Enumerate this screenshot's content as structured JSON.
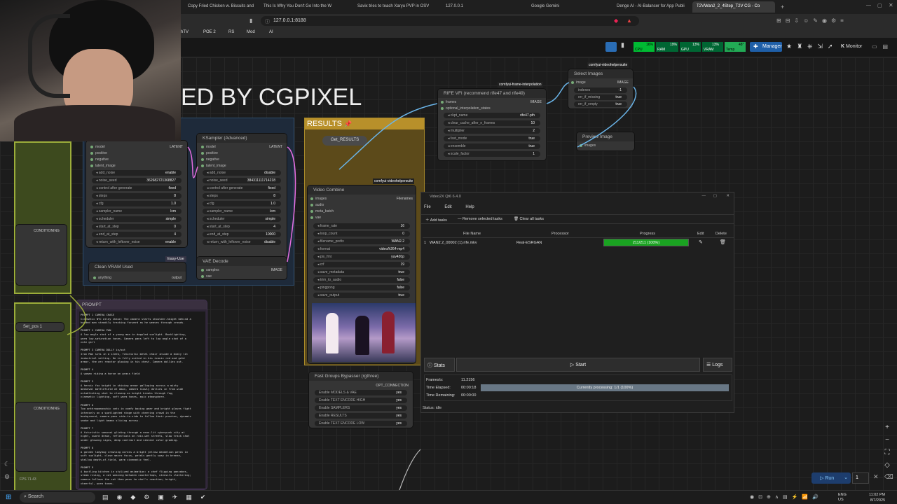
{
  "browser": {
    "tabs": [
      {
        "label": "Copy Fried Chicken w. Biscuits and",
        "active": false
      },
      {
        "label": "This Is Why You Don't Go Into the W",
        "active": false
      },
      {
        "label": "Savix tries to teach Xaryu PVP in OSV",
        "active": false
      },
      {
        "label": "127.0.0.1",
        "active": false
      },
      {
        "label": "Google Gemini",
        "active": false
      },
      {
        "label": "Denge AI - AI-Balancer for App Publi",
        "active": false
      },
      {
        "label": "T2VWan2_2_4Step_T2V CG - Co",
        "active": true
      }
    ],
    "address": "127.0.0.1:8188",
    "bookmarks": [
      "hTV",
      "POE 2",
      "RS",
      "Mod",
      "AI"
    ]
  },
  "topmenu": {
    "stats": [
      {
        "label": "CPU",
        "value": "16%"
      },
      {
        "label": "RAM",
        "value": "19%"
      },
      {
        "label": "GPU",
        "value": "13%"
      },
      {
        "label": "VRAM",
        "value": "13%"
      },
      {
        "label": "Temp",
        "value": "48°"
      }
    ],
    "manager_label": "Manager",
    "monitor_label": "Monitor"
  },
  "canvas": {
    "banner": "ED BY CGPIXEL",
    "results_label": "RESULTS",
    "get_results": "Get_RESULTS",
    "conditioning_1": "CONDITIONING",
    "conditioning_2": "CONDITIONING",
    "set_pos": "Set_pos 1",
    "fps": "FPS 71.43",
    "ksampler_left": {
      "inputs": [
        "model",
        "positive",
        "negative",
        "latent_image"
      ],
      "output": "LATENT",
      "widgets": [
        {
          "k": "add_noise",
          "v": "enable"
        },
        {
          "k": "noise_seed",
          "v": "362682721368827"
        },
        {
          "k": "control after generate",
          "v": "fixed"
        },
        {
          "k": "steps",
          "v": "8"
        },
        {
          "k": "cfg",
          "v": "1.0"
        },
        {
          "k": "sampler_name",
          "v": "lcm"
        },
        {
          "k": "scheduler",
          "v": "simple"
        },
        {
          "k": "start_at_step",
          "v": "0"
        },
        {
          "k": "end_at_step",
          "v": "4"
        },
        {
          "k": "return_with_leftover_noise",
          "v": "enable"
        }
      ]
    },
    "ksampler_right": {
      "title": "KSampler (Advanced)",
      "inputs": [
        "model",
        "positive",
        "negative",
        "latent_image"
      ],
      "output": "LATENT",
      "widgets": [
        {
          "k": "add_noise",
          "v": "disable"
        },
        {
          "k": "noise_seed",
          "v": "384311111714218"
        },
        {
          "k": "control after generate",
          "v": "fixed"
        },
        {
          "k": "steps",
          "v": "8"
        },
        {
          "k": "cfg",
          "v": "1.0"
        },
        {
          "k": "sampler_name",
          "v": "lcm"
        },
        {
          "k": "scheduler",
          "v": "simple"
        },
        {
          "k": "start_at_step",
          "v": "4"
        },
        {
          "k": "end_at_step",
          "v": "10000"
        },
        {
          "k": "return_with_leftover_noise",
          "v": "disable"
        }
      ],
      "badge": "Easy-Use"
    },
    "clean_vram": {
      "title": "Clean VRAM Used",
      "input": "anything",
      "output": "output"
    },
    "vae_decode": {
      "title": "VAE Decode",
      "inputs": [
        "samples",
        "vae"
      ],
      "output": "IMAGE"
    },
    "video_combine": {
      "tag": "comfyui-videohelpersuite",
      "title": "Video Combine",
      "inputs": [
        "images",
        "audio",
        "meta_batch",
        "vae"
      ],
      "output": "Filenames",
      "widgets": [
        {
          "k": "frame_rate",
          "v": "16"
        },
        {
          "k": "loop_count",
          "v": "0"
        },
        {
          "k": "filename_prefix",
          "v": "WAN2.2"
        },
        {
          "k": "format",
          "v": "video/h264-mp4"
        },
        {
          "k": "pix_fmt",
          "v": "yuv420p"
        },
        {
          "k": "crf",
          "v": "19"
        },
        {
          "k": "save_metadata",
          "v": "true"
        },
        {
          "k": "trim_to_audio",
          "v": "false"
        },
        {
          "k": "pingpong",
          "v": "false"
        },
        {
          "k": "save_output",
          "v": "true"
        }
      ]
    },
    "rife": {
      "tag": "comfyui-frame-interpolation",
      "title": "RIFE VFI (recommend rife47 and rife49)",
      "inputs": [
        "frames",
        "optional_interpolation_states"
      ],
      "output": "IMAGE",
      "widgets": [
        {
          "k": "ckpt_name",
          "v": "rife47.pth"
        },
        {
          "k": "clear_cache_after_n_frames",
          "v": "10"
        },
        {
          "k": "multiplier",
          "v": "2"
        },
        {
          "k": "fast_mode",
          "v": "true"
        },
        {
          "k": "ensemble",
          "v": "true"
        },
        {
          "k": "scale_factor",
          "v": "1"
        }
      ]
    },
    "select_images": {
      "tag": "comfyui-videohelpersuite",
      "title": "Select Images",
      "input": "image",
      "output": "IMAGE",
      "widgets": [
        {
          "k": "indexes",
          "v": "-1"
        },
        {
          "k": "err_if_missing",
          "v": "true"
        },
        {
          "k": "err_if_empty",
          "v": "true"
        }
      ]
    },
    "preview_image": {
      "title": "Preview Image",
      "input": "images"
    },
    "prompt": {
      "title": "PROMPT",
      "lines": [
        "PROMPT 1 CAMERA CHASE",
        "Cinematic NYC alley chase: The camera starts shoulder-height behind a",
        "hooded man steadily tracking forward as he weaves through crowds.",
        "",
        "PROMPT 2 CAMERA PAN",
        "A low angle shot of a young man in dappled sunlight. Backlighting,",
        "warm low-saturation tones. Camera pans left to low angle shot of a",
        "cute girl",
        "",
        "PROMPT 3 CAMERA DOLLY in/out",
        "Iron Man sits in a sleek, futuristic metal chair inside a dimly lit",
        "industrial setting. He is fully suited in his iconic red and gold",
        "armor, the arc reactor glowing in his chest. Camera dollies out.",
        "",
        "PROMPT 4",
        "A woman riding a horse on grass field",
        "",
        "PROMPT 5",
        "A heroic fox knight in shining armor galloping across a misty",
        "medieval battlefield at dawn, camera slowly dollies in from wide",
        "establishing shot to closeup as knight breaks through fog;",
        "cinematic lighting, soft warm tones, epic atmosphere.",
        "",
        "PROMPT 6",
        "Two anthropomorphic cats in comfy boxing gear and bright gloves fight",
        "intensely on a spotlighted stage with cheering crowd in the",
        "background, camera pans side-to-side to follow their punches, dynamic",
        "smoke and light beams slicing across.",
        "",
        "PROMPT 7",
        "A futuristic samurai gliding through a neon-lit cyberpunk city at",
        "night, sword drawn, reflections on rain-wet streets, slow track shot",
        "under glowing signs, deep contrast and vibrant color grading.",
        "",
        "PROMPT 8",
        "A golden ladybug crawling across a bright yellow dandelion petal in",
        "soft sunlight, close macro focus, petals gently sway in breeze,",
        "shallow depth-of-field, warm cinematic feel.",
        "",
        "PROMPT 9",
        "A bustling kitchen in stylized animation: a chef flipping pancakes,",
        "steam rising, a cat weaving between countertops, utensils clattering;",
        "camera follows the cat then pans to chef's reaction; bright,",
        "cheerful, warm tones."
      ]
    },
    "fast_groups": {
      "title": "Fast Groups Bypasser (rgthree)",
      "output": "OPT_CONNECTION",
      "rows": [
        {
          "k": "Enable MODELS & VAE",
          "v": "yes"
        },
        {
          "k": "Enable TEXT ENCODE HIGH",
          "v": "yes"
        },
        {
          "k": "Enable SAMPLERS",
          "v": "yes"
        },
        {
          "k": "Enable RESULTS",
          "v": "yes"
        },
        {
          "k": "Enable TEXT ENCODE LOW",
          "v": "yes"
        }
      ]
    },
    "run_label": "Run",
    "queue_count": "1"
  },
  "video2x": {
    "title": "Video2X Qt6 6.4.0",
    "menu": [
      "File",
      "Edit",
      "Help"
    ],
    "toolbar": {
      "add": "Add tasks",
      "remove": "Remove selected tasks",
      "clear": "Clear all tasks"
    },
    "columns": [
      "File Name",
      "Processor",
      "Progress",
      "Edit",
      "Delete"
    ],
    "rows": [
      {
        "index": "1",
        "file": "WAN2.2_00002 (1).rife.mkv",
        "processor": "Real-ESRGAN",
        "progress_text": "211/211 (100%)",
        "progress": 1.0
      }
    ],
    "stats_btn": "Stats",
    "start_btn": "Start",
    "logs_btn": "Logs",
    "stats": [
      {
        "k": "Frames/s:",
        "v": "11.2156"
      },
      {
        "k": "Time Elapsed:",
        "v": "00:00:18"
      },
      {
        "k": "Time Remaining:",
        "v": "00:00:00"
      }
    ],
    "current": "Currently processing: 1/1 (100%)",
    "current_progress": 1.0,
    "status": "Status: idle"
  },
  "taskbar": {
    "search": "Search",
    "lang": "ENG\nUS",
    "time": "11:02 PM",
    "date": "8/7/2025"
  }
}
